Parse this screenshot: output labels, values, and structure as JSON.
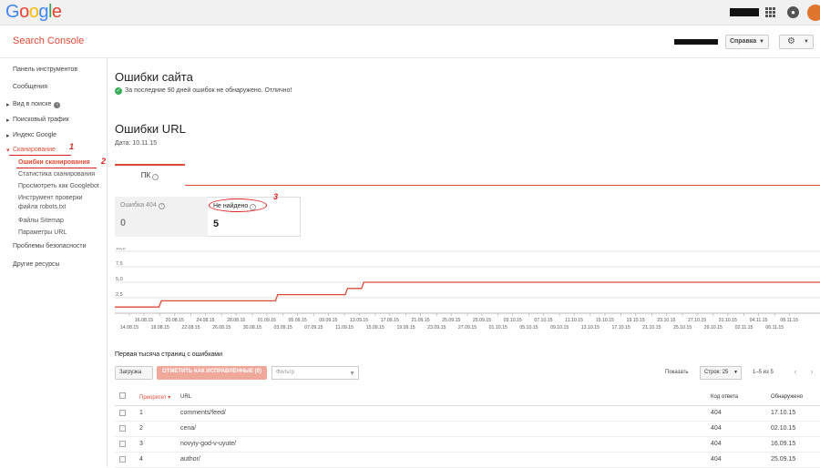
{
  "brand": {
    "google_letters": [
      {
        "ch": "G",
        "color": "#4285f4"
      },
      {
        "ch": "o",
        "color": "#ea4335"
      },
      {
        "ch": "o",
        "color": "#fbbc05"
      },
      {
        "ch": "g",
        "color": "#4285f4"
      },
      {
        "ch": "l",
        "color": "#34a853"
      },
      {
        "ch": "e",
        "color": "#ea4335"
      }
    ],
    "product": "Search Console"
  },
  "header": {
    "help_label": "Справка",
    "settings_icon": "gear-icon",
    "apps_icon": "apps-grid-icon",
    "notifications_icon": "bell-icon"
  },
  "sidebar": {
    "items": [
      {
        "label": "Панель инструментов"
      },
      {
        "label": "Сообщения"
      },
      {
        "label": "Вид в поиске"
      },
      {
        "label": "Поисковый трафик"
      },
      {
        "label": "Индекс Google"
      },
      {
        "label": "Сканирование"
      },
      {
        "label": "Проблемы безопасности"
      },
      {
        "label": "Другие ресурсы"
      }
    ],
    "crawl_subitems": [
      {
        "label": "Ошибки сканирования"
      },
      {
        "label": "Статистика сканирования"
      },
      {
        "label": "Просмотреть как Googlebot"
      },
      {
        "label": "Инструмент проверки файла robots.txt"
      },
      {
        "label": "Файлы Sitemap"
      },
      {
        "label": "Параметры URL"
      }
    ]
  },
  "annotations": {
    "a1": "1",
    "a2": "2",
    "a3": "3"
  },
  "site_errors": {
    "title": "Ошибки сайта",
    "status": "За последние 90 дней ошибок не обнаружено. Отлично!"
  },
  "url_errors": {
    "title": "Ошибки URL",
    "date": "Дата: 10.11.15",
    "tab": "ПК",
    "cards": [
      {
        "label": "Ошибка 404",
        "value": "0"
      },
      {
        "label": "Не найдено",
        "value": "5"
      }
    ]
  },
  "chart_data": {
    "type": "line",
    "y_ticks": [
      "10,0",
      "7,5",
      "5,0",
      "2,5"
    ],
    "ylim": [
      0,
      10
    ],
    "x_labels_top": [
      "16.08.15",
      "20.08.15",
      "24.08.15",
      "28.08.15",
      "01.09.15",
      "05.09.15",
      "09.09.15",
      "13.09.15",
      "17.09.15",
      "21.09.15",
      "25.09.15",
      "29.09.15",
      "03.10.15",
      "07.10.15",
      "11.10.15",
      "15.10.15",
      "19.10.15",
      "23.10.15",
      "27.10.15",
      "31.10.15",
      "04.11.15",
      "08.11.15"
    ],
    "x_labels_bottom": [
      "14.08.15",
      "18.08.15",
      "22.08.15",
      "26.08.15",
      "30.08.15",
      "03.09.15",
      "07.09.15",
      "11.09.15",
      "15.09.15",
      "19.09.15",
      "23.09.15",
      "27.09.15",
      "01.10.15",
      "05.10.15",
      "09.10.15",
      "13.10.15",
      "17.10.15",
      "21.10.15",
      "25.10.15",
      "29.10.15",
      "02.11.15",
      "06.11.15"
    ],
    "series": [
      {
        "values": [
          1,
          1,
          1,
          1,
          1,
          1,
          1,
          1,
          1,
          1,
          1,
          1,
          1,
          1,
          1,
          1,
          1,
          1,
          1,
          1,
          2,
          2,
          2,
          2,
          2,
          2,
          2,
          2,
          2,
          2,
          2,
          2,
          2,
          2,
          2,
          2,
          2,
          2,
          2,
          2,
          2,
          2,
          2,
          2,
          2,
          2,
          2,
          2,
          2,
          2,
          2,
          2,
          2,
          2,
          2,
          2,
          2,
          2,
          2,
          2,
          2,
          2,
          2,
          2,
          2,
          2,
          2,
          2,
          2,
          2,
          3,
          3,
          3,
          3,
          3,
          3,
          3,
          3,
          3,
          3,
          3,
          3,
          3,
          3,
          3,
          3,
          3,
          3,
          3,
          3,
          3,
          3,
          3,
          3,
          3,
          3,
          3,
          3,
          3,
          3,
          4,
          4,
          4,
          4,
          4,
          4,
          4,
          5,
          5,
          5,
          5,
          5,
          5,
          5,
          5,
          5,
          5,
          5,
          5,
          5,
          5,
          5,
          5,
          5,
          5,
          5,
          5,
          5,
          5,
          5,
          5,
          5,
          5,
          5,
          5,
          5,
          5,
          5,
          5,
          5,
          5,
          5,
          5,
          5,
          5,
          5,
          5,
          5,
          5,
          5,
          5,
          5,
          5,
          5,
          5,
          5,
          5,
          5,
          5,
          5,
          5,
          5,
          5,
          5,
          5,
          5,
          5,
          5,
          5,
          5,
          5,
          5,
          5,
          5,
          5,
          5,
          5,
          5,
          5,
          5,
          5,
          5,
          5,
          5,
          5,
          5,
          5,
          5,
          5,
          5,
          5,
          5,
          5,
          5,
          5,
          5,
          5,
          5,
          5,
          5,
          5,
          5,
          5,
          5,
          5,
          5,
          5,
          5,
          5,
          5,
          5,
          5,
          5,
          5,
          5,
          5,
          5,
          5,
          5,
          5,
          5,
          5,
          5,
          5,
          5,
          5,
          5,
          5,
          5,
          5,
          5,
          5,
          5,
          5,
          5,
          5,
          5,
          5,
          5,
          5,
          5,
          5,
          5,
          5,
          5,
          5,
          5,
          5,
          5,
          5,
          5,
          5,
          5,
          5,
          5,
          5,
          5,
          5,
          5,
          5,
          5,
          5,
          5,
          5,
          5,
          5,
          5,
          5,
          5,
          5,
          5,
          5,
          5,
          5,
          5,
          5,
          5,
          5,
          5,
          5,
          5,
          5,
          5,
          5,
          5,
          5,
          5,
          5,
          5,
          5,
          5,
          5,
          5,
          5,
          5,
          5,
          5,
          5,
          5,
          5,
          5,
          5,
          5,
          5
        ],
        "color": "#dd4b39"
      }
    ],
    "grid": true,
    "xlabel": "",
    "ylabel": ""
  },
  "table": {
    "title": "Первая тысяча страниц с ошибками",
    "download_label": "Загрузка",
    "mark_fixed_label": "ОТМЕТИТЬ КАК ИСПРАВЛЕННЫЕ (0)",
    "filter_placeholder": "Фильтр",
    "show_label": "Показать",
    "rows_select": "Строк: 25",
    "range": "1–5 из 5",
    "columns": {
      "priority": "Приоритет",
      "url": "URL",
      "code": "Код ответа",
      "detected": "Обнаружено"
    },
    "rows": [
      {
        "priority": "1",
        "url": "comments/feed/",
        "code": "404",
        "detected": "17.10.15"
      },
      {
        "priority": "2",
        "url": "cena/",
        "code": "404",
        "detected": "02.10.15"
      },
      {
        "priority": "3",
        "url": "novyiy-god-v-uyute/",
        "code": "404",
        "detected": "16.09.15"
      },
      {
        "priority": "4",
        "url": "author/",
        "code": "404",
        "detected": "25.09.15"
      }
    ]
  }
}
